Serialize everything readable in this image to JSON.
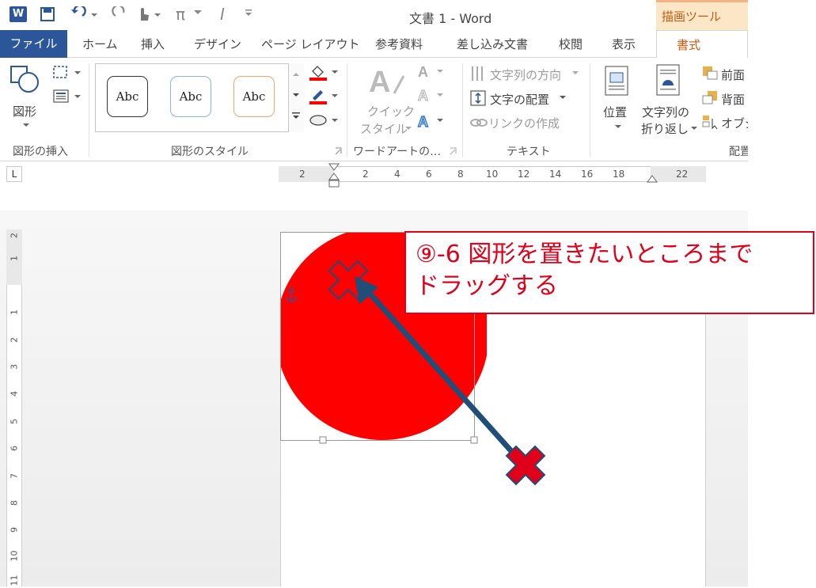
{
  "title_bar": {
    "document_title": "文書 1 - Word",
    "context_tab_header": "描画ツール",
    "app_icon": "word-icon",
    "qat_icons": [
      "save-icon",
      "undo-icon",
      "redo-icon",
      "touch-mode-icon",
      "equation-icon",
      "italic-icon",
      "customize-qat-icon"
    ],
    "qat_pi": "π",
    "qat_i": "I"
  },
  "tabs": {
    "file": "ファイル",
    "home": "ホーム",
    "insert": "挿入",
    "design": "デザイン",
    "layout": "ページ レイアウト",
    "references": "参考資料",
    "mailings": "差し込み文書",
    "review": "校閲",
    "view": "表示",
    "format": "書式"
  },
  "ribbon": {
    "insert_shapes": {
      "shapes_label": "図形",
      "group_label": "図形の挿入"
    },
    "shape_styles": {
      "style_samples": [
        "Abc",
        "Abc",
        "Abc"
      ],
      "group_label": "図形のスタイル"
    },
    "wordart": {
      "quick_styles_line1": "クイック",
      "quick_styles_line2": "スタイル",
      "group_label": "ワードアートの…"
    },
    "text": {
      "text_direction": "文字列の方向",
      "align_text": "文字の配置",
      "create_link": "リンクの作成",
      "group_label": "テキスト"
    },
    "arrange": {
      "position": "位置",
      "wrap_text_line1": "文字列の",
      "wrap_text_line2": "折り返し",
      "bring_forward": "前面",
      "send_backward": "背面",
      "selection_pane": "オブジ",
      "group_label": "配置"
    }
  },
  "ruler": {
    "tab_selector": "L",
    "horizontal_ticks": [
      "2",
      "2",
      "4",
      "6",
      "8",
      "10",
      "12",
      "14",
      "16",
      "18",
      "22"
    ],
    "vertical_ticks": [
      "2",
      "1",
      "1",
      "2",
      "3",
      "4",
      "5",
      "6",
      "7",
      "8",
      "9",
      "10",
      "11"
    ]
  },
  "callout": {
    "line1": "⑨-6 図形を置きたいところまで",
    "line2": "ドラッグする"
  },
  "colors": {
    "word_blue": "#2b579a",
    "context_orange": "#c55a11",
    "shape_red": "#ff0000",
    "arrow_navy": "#1f4e79",
    "callout_red": "#e0001a"
  }
}
